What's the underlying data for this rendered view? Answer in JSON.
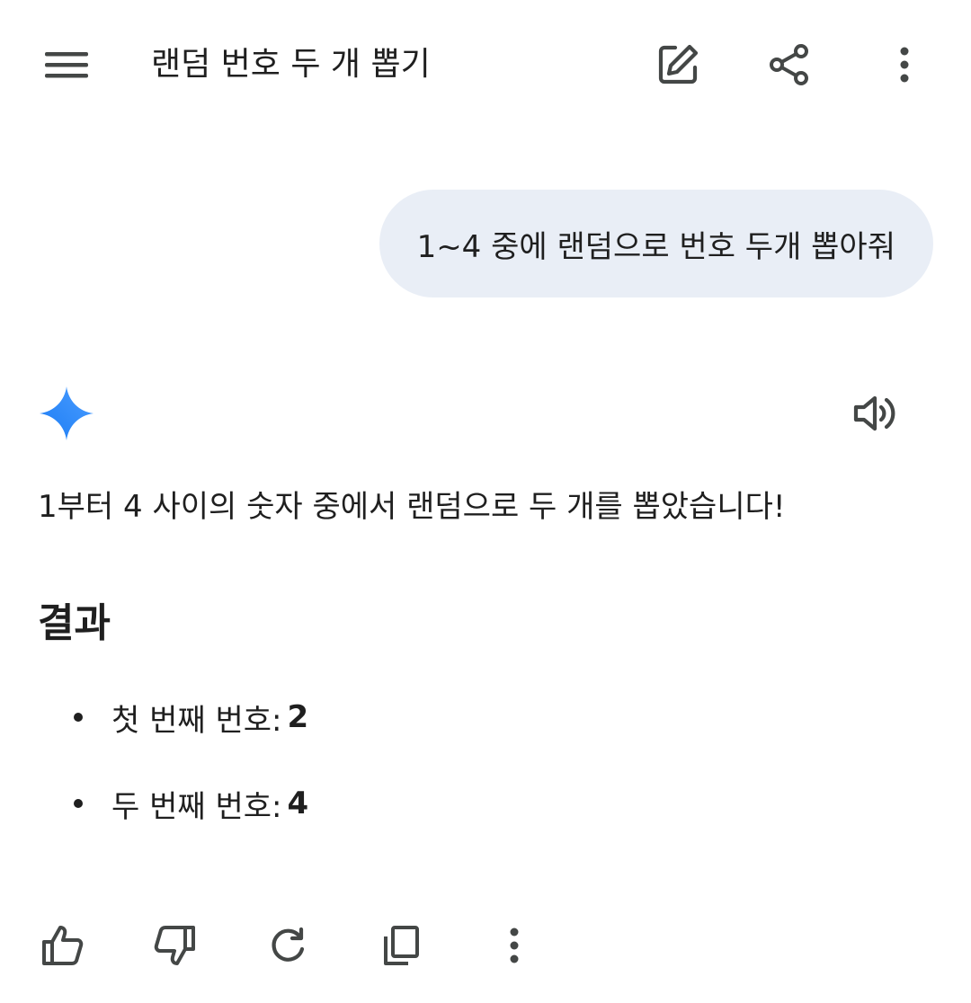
{
  "header": {
    "title": "랜덤 번호 두 개 뽑기",
    "icons": [
      "menu-icon",
      "edit-icon",
      "share-icon",
      "more-vert-icon"
    ]
  },
  "user_message": {
    "text": "1~4 중에 랜덤으로 번호 두개 뽑아줘"
  },
  "response": {
    "icons": [
      "gemini-sparkle-icon",
      "speaker-icon"
    ],
    "intro": "1부터 4 사이의 숫자 중에서 랜덤으로 두 개를 뽑았습니다!",
    "heading": "결과",
    "items": [
      {
        "label": "첫 번째 번호:",
        "value": "2"
      },
      {
        "label": "두 번째 번호:",
        "value": "4"
      }
    ]
  },
  "actions": {
    "icons": [
      "thumbs-up-icon",
      "thumbs-down-icon",
      "regenerate-icon",
      "copy-icon",
      "more-vert-icon"
    ]
  },
  "colors": {
    "user_bubble_bg": "#e9eef6",
    "text": "#1f1f1f",
    "icon": "#444746",
    "gemini_gradient_start": "#1c7cf4",
    "gemini_gradient_end": "#4a9dff"
  }
}
